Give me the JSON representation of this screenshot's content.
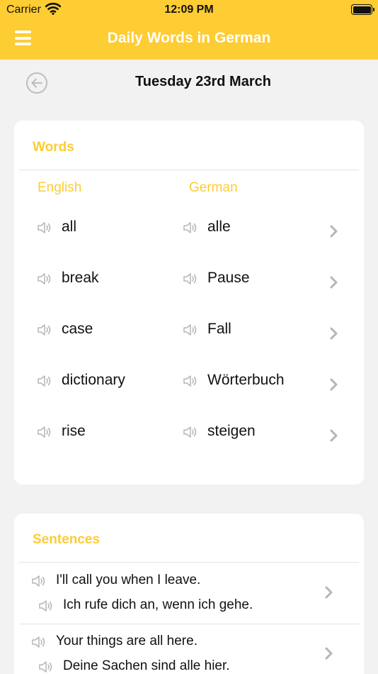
{
  "status": {
    "carrier": "Carrier",
    "time": "12:09 PM"
  },
  "nav": {
    "title": "Daily Words in German"
  },
  "date": "Tuesday 23rd March",
  "words": {
    "title": "Words",
    "col_english": "English",
    "col_german": "German",
    "rows": [
      {
        "english": "all",
        "german": "alle"
      },
      {
        "english": "break",
        "german": "Pause"
      },
      {
        "english": "case",
        "german": "Fall"
      },
      {
        "english": "dictionary",
        "german": "Wörterbuch"
      },
      {
        "english": "rise",
        "german": "steigen"
      }
    ]
  },
  "sentences": {
    "title": "Sentences",
    "rows": [
      {
        "english": "I'll call you when I leave.",
        "german": "Ich rufe dich an, wenn ich gehe."
      },
      {
        "english": "Your things are all here.",
        "german": "Deine Sachen sind alle hier."
      }
    ]
  },
  "colors": {
    "accent": "#fecc33",
    "background": "#f2f2f2",
    "card": "#ffffff",
    "icon_gray": "#b5b5b5"
  }
}
